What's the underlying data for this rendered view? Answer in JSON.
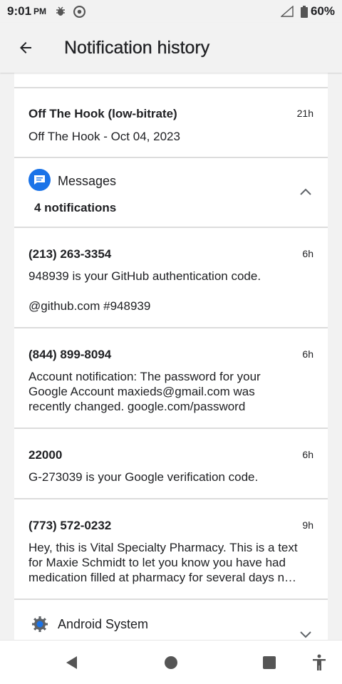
{
  "status_bar": {
    "time": "9:01",
    "ampm": "PM",
    "battery": "60%"
  },
  "app_bar": {
    "title": "Notification history"
  },
  "items": [
    {
      "title": "Off The Hook (low-bitrate)",
      "time": "21h",
      "body": "Off The Hook - Oct 04, 2023"
    }
  ],
  "messages_group": {
    "app_name": "Messages",
    "count": "4 notifications",
    "accent": "#1a73e8",
    "notifications": [
      {
        "title": "(213) 263-3354",
        "time": "6h",
        "body": "948939 is your GitHub authentication code.",
        "extra": "@github.com #948939"
      },
      {
        "title": "(844) 899-8094",
        "time": "6h",
        "body": "Account notification: The password for your Google Account maxieds@gmail.com was recently changed. google.com/password"
      },
      {
        "title": "22000",
        "time": "6h",
        "body": "G-273039 is your Google verification code."
      },
      {
        "title": "(773) 572-0232",
        "time": "9h",
        "body": "Hey, this is Vital Specialty Pharmacy. This is a text for Maxie Schmidt to let you know you have had medication filled at pharmacy for several days n…"
      }
    ]
  },
  "android_group": {
    "app_name": "Android System"
  }
}
